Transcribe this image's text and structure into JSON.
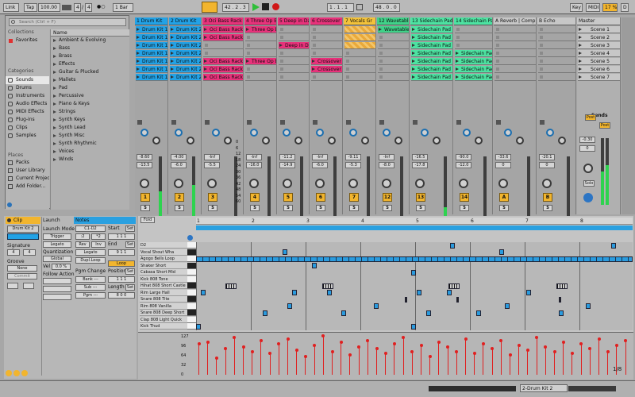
{
  "topbar": {
    "link": "Link",
    "tap": "Tap",
    "tempo": "100.00",
    "sig_num": "4",
    "sig_sep": "/",
    "sig_den": "4",
    "metronome": "●○",
    "quant": "1 Bar",
    "position": "42 . 2 . 3",
    "loop_start": "1 . 1 . 1",
    "loop_len": "48 . 0 . 0",
    "key": "Key",
    "midi": "MIDI",
    "cpu": "17 %",
    "disk": "D"
  },
  "browser": {
    "search_placeholder": "Search (Ctrl + F)",
    "collections_label": "Collections",
    "favorites": "Favorites",
    "places_label": "Categories",
    "categories": [
      "Sounds",
      "Drums",
      "Instruments",
      "Audio Effects",
      "MIDI Effects",
      "Plug-ins",
      "Clips",
      "Samples"
    ],
    "places_title": "Places",
    "places": [
      "Packs",
      "User Library",
      "Current Project",
      "Add Folder..."
    ],
    "name_header": "Name",
    "items": [
      "Ambient & Evolving",
      "Bass",
      "Brass",
      "Effects",
      "Guitar & Plucked",
      "Mallets",
      "Pad",
      "Percussive",
      "Piano & Keys",
      "Strings",
      "Synth Keys",
      "Synth Lead",
      "Synth Misc",
      "Synth Rhythmic",
      "Voices",
      "Winds"
    ]
  },
  "tracks": [
    {
      "name": "1 Drum Kit",
      "color": "#22a2e6",
      "num": "1",
      "vol": "-8.60",
      "peak": "-13.5"
    },
    {
      "name": "2 Drum Kit",
      "color": "#22a2e6",
      "num": "2",
      "vol": "-4.00",
      "peak": "-6.0"
    },
    {
      "name": "3 Oci Bass Rack",
      "color": "#e8327b",
      "num": "3",
      "vol": "-Inf",
      "peak": "-5.5"
    },
    {
      "name": "4 Three Op Ba",
      "color": "#e8327b",
      "num": "4",
      "vol": "-Inf",
      "peak": "-16.0"
    },
    {
      "name": "5 Deep in Dark",
      "color": "#e8327b",
      "num": "5",
      "vol": "-11.2",
      "peak": "-14.9"
    },
    {
      "name": "6 Crossover Sy",
      "color": "#e8327b",
      "num": "6",
      "vol": "-Inf",
      "peak": "-6.0"
    },
    {
      "name": "7 Vocals Gr",
      "color": "#f3c23a",
      "num": "7",
      "vol": "-9.11",
      "peak": "-5.3"
    },
    {
      "name": "12 Wavetable",
      "color": "#40d289",
      "num": "12",
      "vol": "-Inf",
      "peak": "-8.0"
    },
    {
      "name": "13 Sidechain Pad",
      "color": "#4de3a2",
      "num": "13",
      "vol": "-16.5",
      "peak": "-17.8"
    },
    {
      "name": "14 Sidechain Pad",
      "color": "#4de3a2",
      "num": "14",
      "vol": "-90.0",
      "peak": "-12.0"
    },
    {
      "name": "A Reverb | Compre",
      "color": "#c7c7c7",
      "num": "A",
      "vol": "-33.6",
      "peak": "0"
    },
    {
      "name": "B Echo",
      "color": "#c7c7c7",
      "num": "B",
      "vol": "-20.1",
      "peak": "0"
    }
  ],
  "clips": {
    "drum1": [
      "Drum Kit 1",
      "Drum Kit 1",
      "Drum Kit 1",
      "Drum Kit 1",
      "Drum Kit 1",
      "Drum Kit 1",
      "Drum Kit 1"
    ],
    "drum2": [
      "Drum Kit 2",
      "Drum Kit 2",
      "Drum Kit 2",
      "Drum Kit 2",
      "Drum Kit 2",
      "Drum Kit 2",
      "Drum Kit 2"
    ],
    "bass3": [
      "Oci Bass Rack",
      "Oci Bass Rack",
      "Oci Bass Rack",
      "Oci Bass Rack",
      "Oci Bass Rack"
    ],
    "three": "Three Op Ba",
    "deep": "Deep in Dark",
    "cross": "Crossover S",
    "wave": "Wavetable P",
    "pad": "Sidechain Pad"
  },
  "master": {
    "name": "Master",
    "scenes": [
      "Scene 1",
      "Scene 2",
      "Scene 3",
      "Scene 4",
      "Scene 5",
      "Scene 6",
      "Scene 7"
    ],
    "vol": "-0.30",
    "peak": "0",
    "solo": "Solo",
    "post": "Post",
    "sends": "Sends"
  },
  "meter_scale": [
    "0",
    "6",
    "12",
    "18",
    "24",
    "30",
    "36",
    "42",
    "48",
    "54",
    "60"
  ],
  "clip_panel": {
    "clip_tab": "Clip",
    "clip_name": "Drum Kit 2",
    "signature_label": "Signature",
    "sig_num": "4",
    "sig_den": "4",
    "groove_label": "Groove",
    "groove": "None",
    "commit": "Commit",
    "launch_tab": "Launch",
    "launch_mode_label": "Launch Mode",
    "launch_mode": "Trigger",
    "legato": "Legato",
    "quant_label": "Quantization",
    "quant": "Global",
    "vel_label": "Vel",
    "vel": "0.0 %",
    "follow_label": "Follow Action",
    "notes_tab": "Notes",
    "notes_range": "C1-D2",
    "div2": ":2",
    "mul2": "*2",
    "rev": "Rev",
    "inv": "Inv",
    "notes_legato": "Legato",
    "dupl": "Dupl.Loop",
    "start_label": "Start",
    "set": "Set",
    "start_val": "1  1  1",
    "end_label": "End",
    "end_val": "9  1  1",
    "loop_btn": "Loop",
    "pos_label": "Position",
    "pos_val": "1  1  1",
    "length_label": "Length",
    "length_val": "8  0  0",
    "pgm_label": "Pgm Change",
    "bank": "Bank ---",
    "sub": "Sub ---",
    "pgm": "Pgm ---",
    "fold": "Fold"
  },
  "piano": {
    "rows": [
      "D2",
      "Vocal Shout Wha",
      "Agogo Bells Loop",
      "Shaker Short",
      "Cabasa Short Mid",
      "Kick 808 Tone",
      "Hihat 808 Short Castle",
      "Rim Large Hall",
      "Snare 808 Tite",
      "Rim 808 Vanilla",
      "Snare 808 Deep Short",
      "Clap 808 Light Quick",
      "Kick Thud"
    ],
    "bars": [
      "1",
      "2",
      "3",
      "4",
      "5",
      "6",
      "7",
      "8"
    ],
    "vel_scale": [
      "127",
      "96",
      "64",
      "32",
      "0"
    ]
  },
  "status": {
    "bottom_label": "2-Drum Kit 2",
    "zoom": "1/8"
  }
}
